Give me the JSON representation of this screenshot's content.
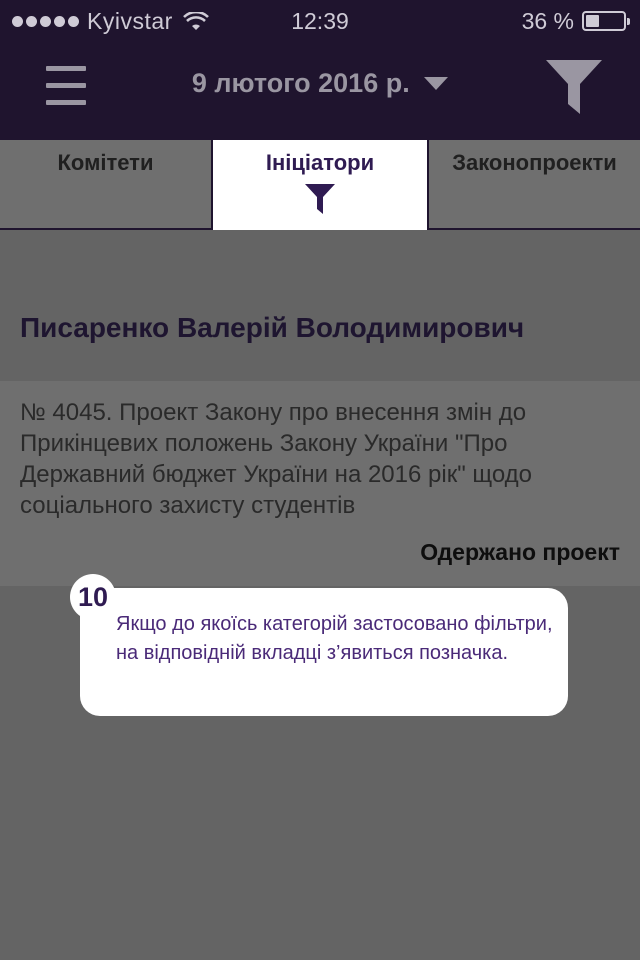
{
  "status_bar": {
    "carrier": "Kyivstar",
    "time": "12:39",
    "battery_percent_text": "36 %",
    "battery_level": 0.36
  },
  "header": {
    "date_label": "9 лютого 2016 р."
  },
  "tabs": [
    {
      "label": "Комітети",
      "active": false
    },
    {
      "label": "Ініціатори",
      "active": true,
      "filter_applied": true
    },
    {
      "label": "Законопроекти",
      "active": false
    }
  ],
  "content": {
    "initiator_name": "Писаренко Валерій Володимирович",
    "bill": {
      "description": "№ 4045. Проект Закону про внесення змін до Прикінцевих положень Закону України \"Про Державний бюджет України на 2016 рік\" щодо соціального захисту студентів",
      "status": "Одержано проект"
    }
  },
  "tooltip": {
    "step_number": "10",
    "text": "Якщо до якоїсь категорій застосовано фільтри, на відповідній вкладці з’явиться позначка."
  },
  "colors": {
    "header_bg": "#1f142e",
    "accent": "#2f1b52",
    "overlay_bg": "#646464",
    "tooltip_text": "#4a2a78"
  }
}
